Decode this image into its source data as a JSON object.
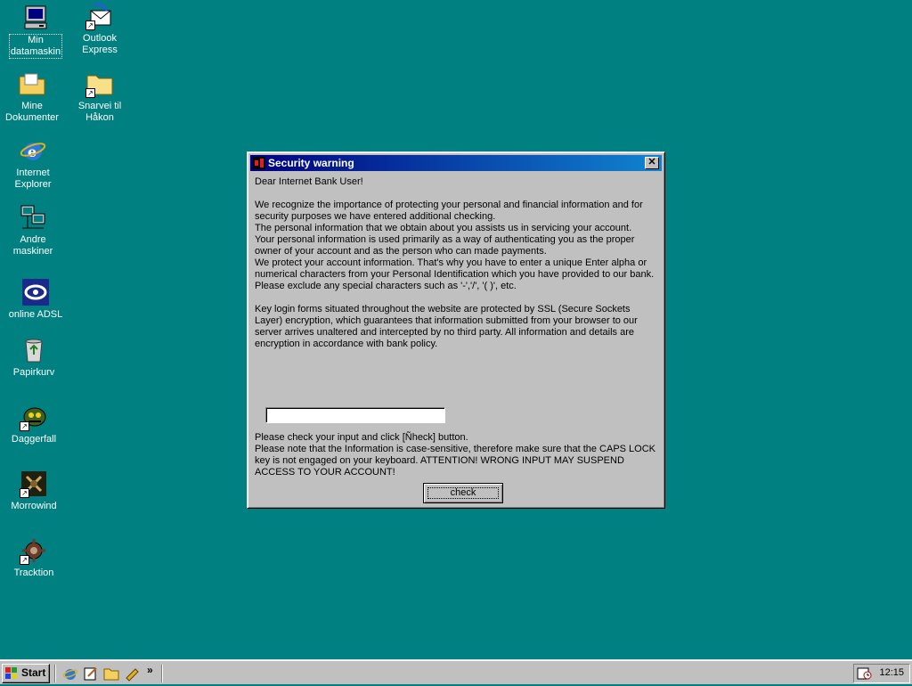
{
  "desktop": {
    "icons": [
      {
        "label_line1": "Min",
        "label_line2": "datamaskin"
      },
      {
        "label_line1": "Outlook",
        "label_line2": "Express"
      },
      {
        "label_line1": "Mine",
        "label_line2": "Dokumenter"
      },
      {
        "label_line1": "Snarvei til",
        "label_line2": "Håkon"
      },
      {
        "label_line1": "Internet",
        "label_line2": "Explorer"
      },
      {
        "label_line1": "Andre",
        "label_line2": "maskiner"
      },
      {
        "label_line1": "online ADSL",
        "label_line2": ""
      },
      {
        "label_line1": "Papirkurv",
        "label_line2": ""
      },
      {
        "label_line1": "Daggerfall",
        "label_line2": ""
      },
      {
        "label_line1": "Morrowind",
        "label_line2": ""
      },
      {
        "label_line1": "Tracktion",
        "label_line2": ""
      }
    ]
  },
  "dialog": {
    "title": "Security warning",
    "close_glyph": "✕",
    "greeting": "Dear Internet Bank User!",
    "paragraph1": "We recognize the importance of protecting your personal and financial information and for security purposes we have entered additional checking.",
    "paragraph2": "The personal information that we obtain about you assists us in servicing your account.",
    "paragraph3": "Your personal information is used primarily as a way of authenticating you as the proper owner of your account and as the person who can made payments.",
    "paragraph4": "We protect your account information. That's why you have to enter a unique Enter alpha or numerical characters from your Personal Identification which you have provided to our bank. Please exclude any special characters such as '-','/', '( )', etc.",
    "paragraph5": "Key login forms situated throughout the website are protected by SSL (Secure Sockets Layer) encryption, which guarantees that information submitted from your browser to our server arrives unaltered and intercepted by no third party. All information and details are encryption in accordance with bank policy.",
    "input_value": "",
    "instruction1": "Please check your input and click [Ñheck] button.",
    "instruction2": "Please note that the Information is case-sensitive, therefore make sure that the CAPS LOCK key is not engaged on your keyboard. ATTENTION! WRONG INPUT MAY SUSPEND ACCESS TO YOUR ACCOUNT!",
    "check_label": "check"
  },
  "taskbar": {
    "start_label": "Start",
    "chevron": "»",
    "clock": "12:15"
  }
}
